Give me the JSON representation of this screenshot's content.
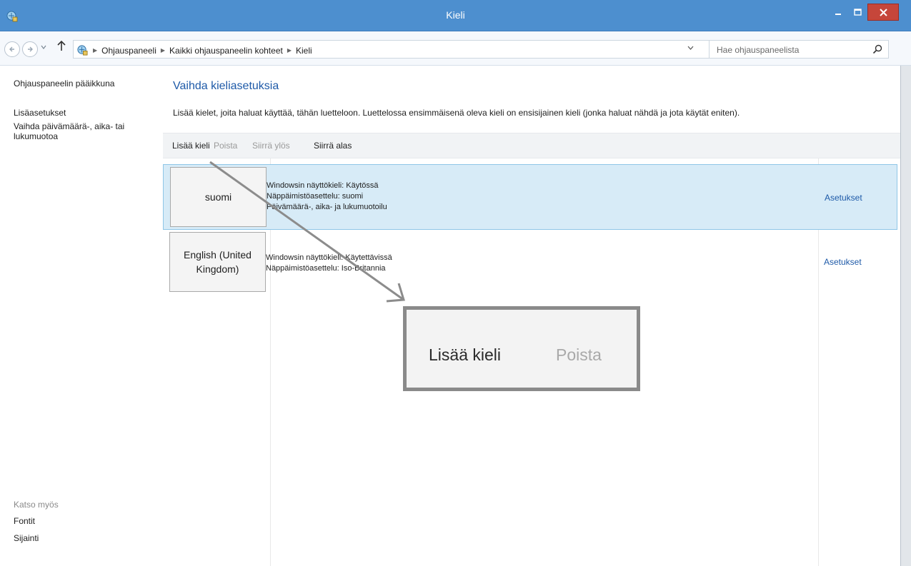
{
  "window": {
    "title": "Kieli",
    "minimize_icon": "minimize-icon",
    "maximize_icon": "maximize-icon",
    "close_icon": "close-icon",
    "close_color": "#c6463a",
    "titlebar_color": "#4d8fcf"
  },
  "address": {
    "breadcrumb": [
      "Ohjauspaneeli",
      "Kaikki ohjauspaneelin kohteet",
      "Kieli"
    ],
    "search_placeholder": "Hae ohjauspaneelista"
  },
  "sidebar": {
    "home": "Ohjauspaneelin pääikkuna",
    "advanced": "Lisäasetukset",
    "date_format": "Vaihda päivämäärä-, aika- tai lukumuotoa",
    "see_also": "Katso myös",
    "fonts": "Fontit",
    "location": "Sijainti"
  },
  "main": {
    "title": "Vaihda kieliasetuksia",
    "description": "Lisää kielet, joita haluat käyttää, tähän luetteloon. Luettelossa ensimmäisenä oleva kieli on ensisijainen kieli (jonka haluat nähdä ja jota käytät eniten)."
  },
  "toolbar": {
    "add": "Lisää kieli",
    "remove": "Poista",
    "move_up": "Siirrä ylös",
    "move_down": "Siirrä alas"
  },
  "languages": [
    {
      "name": "suomi",
      "info": [
        "Windowsin näyttökieli: Käytössä",
        "Näppäimistöasettelu: suomi",
        "Päivämäärä-, aika- ja lukumuotoilu"
      ],
      "settings": "Asetukset",
      "selected": true
    },
    {
      "name": "English (United Kingdom)",
      "info": [
        "Windowsin näyttökieli: Käytettävissä",
        "Näppäimistöasettelu: Iso-Britannia"
      ],
      "settings": "Asetukset",
      "selected": false
    }
  ],
  "callout": {
    "add": "Lisää kieli",
    "remove": "Poista"
  },
  "colors": {
    "link": "#1e5aa8",
    "selected_row": "#d7ebf7",
    "disabled_text": "#9a9a9a"
  }
}
